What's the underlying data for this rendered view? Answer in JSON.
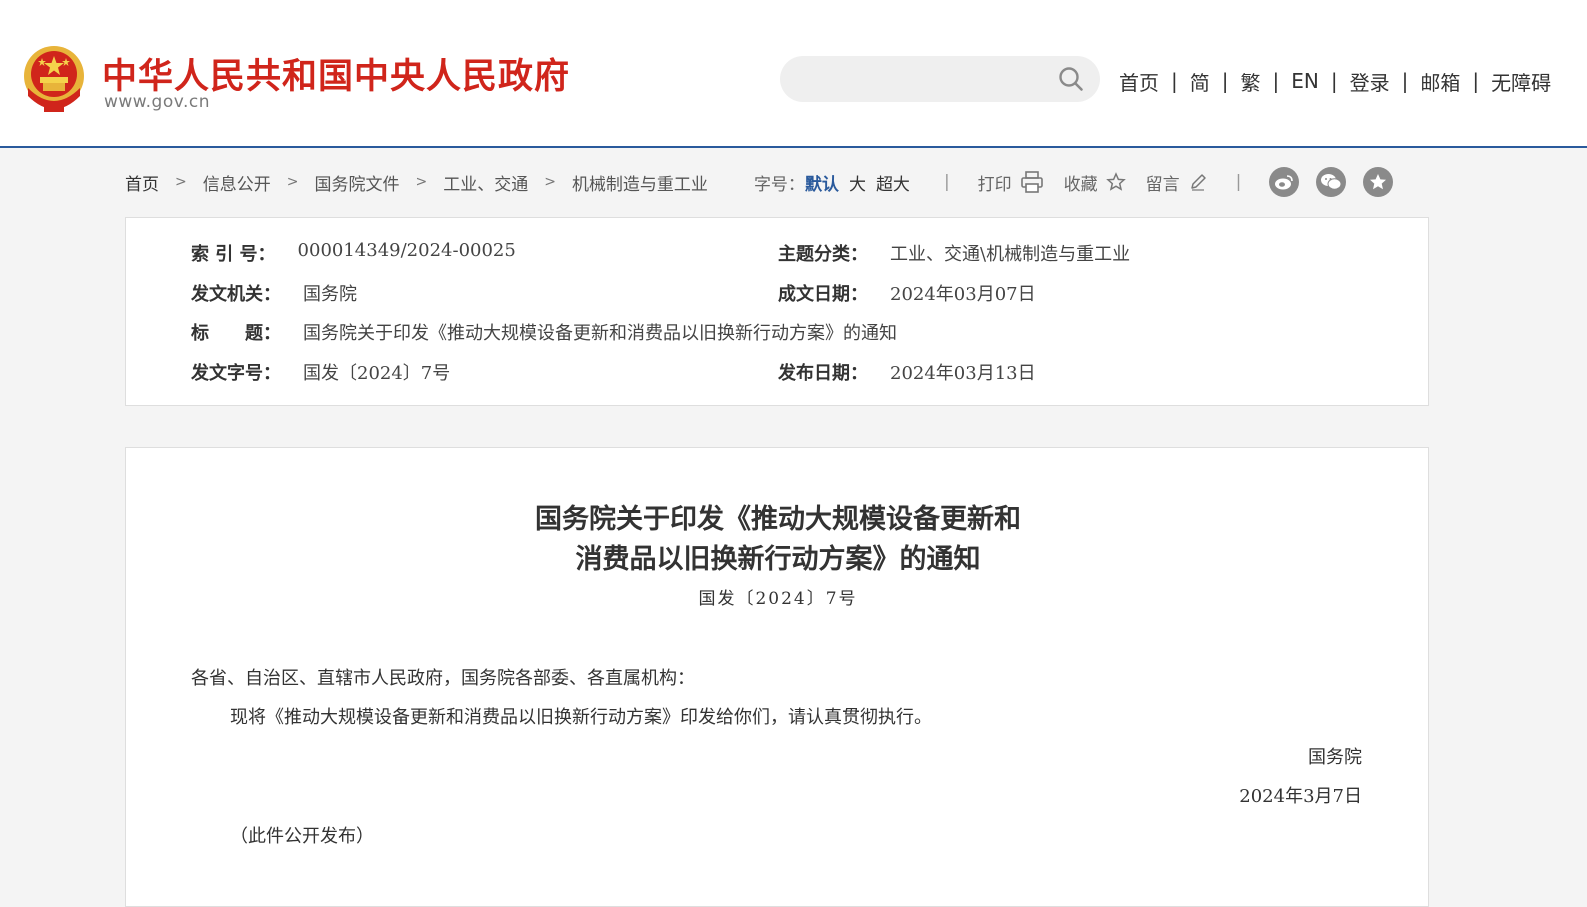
{
  "header": {
    "site_title": "中华人民共和国中央人民政府",
    "site_url": "www.gov.cn",
    "search": {
      "placeholder": ""
    },
    "nav": [
      "首页",
      "简",
      "繁",
      "EN",
      "登录",
      "邮箱",
      "无障碍"
    ],
    "nav_separator": "|"
  },
  "breadcrumb": [
    "首页",
    "信息公开",
    "国务院文件",
    "工业、交通",
    "机械制造与重工业"
  ],
  "toolbar": {
    "font_size_label": "字号：",
    "font_sizes": [
      "默认",
      "大",
      "超大"
    ],
    "print": "打印",
    "favorite": "收藏",
    "comment": "留言",
    "divider": "|",
    "share_icons": [
      "weibo-icon",
      "wechat-icon",
      "qzone-icon"
    ]
  },
  "meta": {
    "index_label": "索 引 号：",
    "index_value": "000014349/2024-00025",
    "topic_label": "主题分类：",
    "topic_value": "工业、交通\\机械制造与重工业",
    "issuer_label": "发文机关：",
    "issuer_value": "国务院",
    "written_date_label": "成文日期：",
    "written_date_value": "2024年03月07日",
    "title_label": "标　　题：",
    "title_value": "国务院关于印发《推动大规模设备更新和消费品以旧换新行动方案》的通知",
    "doc_no_label": "发文字号：",
    "doc_no_value": "国发〔2024〕7号",
    "publish_date_label": "发布日期：",
    "publish_date_value": "2024年03月13日"
  },
  "document": {
    "title_line1": "国务院关于印发《推动大规模设备更新和",
    "title_line2": "消费品以旧换新行动方案》的通知",
    "number": "国发〔2024〕7号",
    "salutation": "各省、自治区、直辖市人民政府，国务院各部委、各直属机构：",
    "body": "现将《推动大规模设备更新和消费品以旧换新行动方案》印发给你们，请认真贯彻执行。",
    "signature": "国务院",
    "date": "2024年3月7日",
    "note": "（此件公开发布）"
  },
  "colors": {
    "brand_red": "#d0251b",
    "accent_blue": "#2a5a9c",
    "emblem_gold": "#e8b43a"
  }
}
